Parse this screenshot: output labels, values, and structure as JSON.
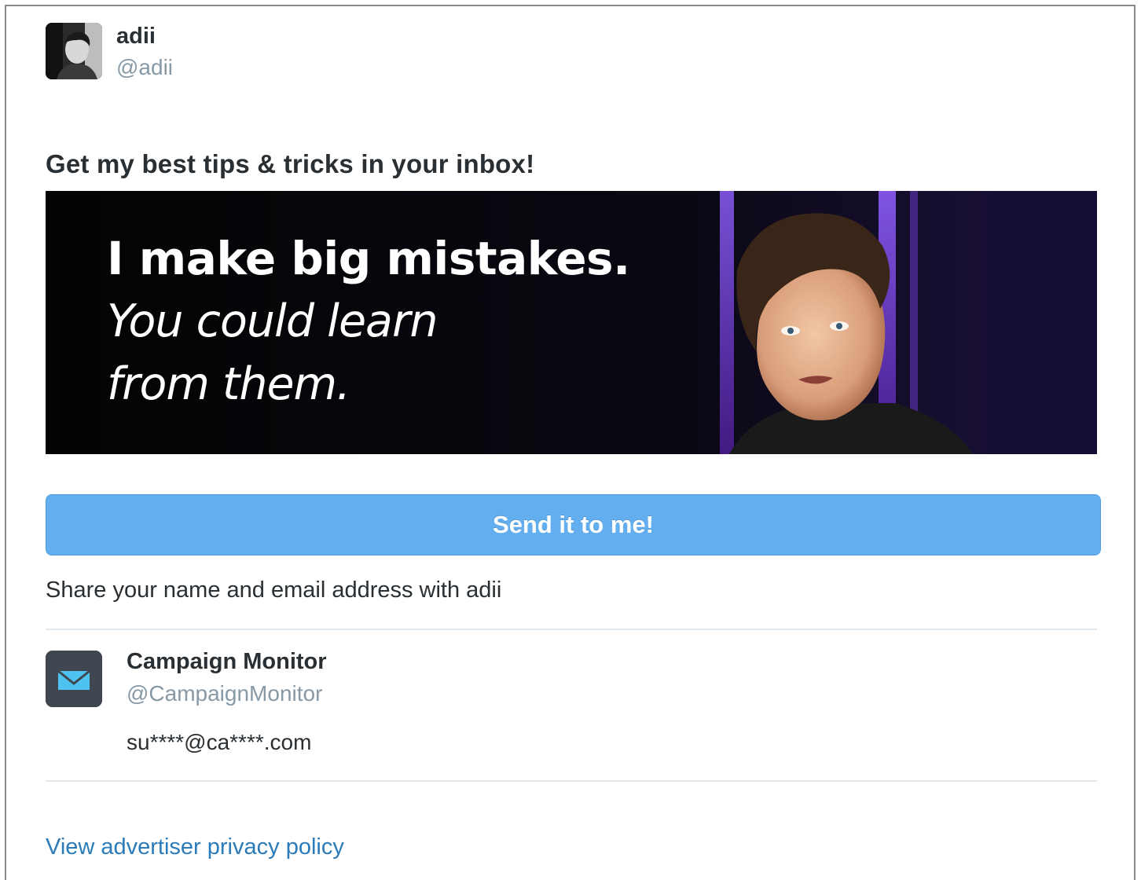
{
  "user": {
    "name": "adii",
    "handle": "@adii",
    "avatar_icon": "profile-photo"
  },
  "card": {
    "headline": "Get my best tips & tricks in your inbox!",
    "banner": {
      "line1": "I make big mistakes.",
      "line2": "You could learn",
      "line3": "from them."
    },
    "cta_label": "Send it to me!",
    "share_text": "Share your name and email address with adii"
  },
  "advertiser": {
    "name": "Campaign Monitor",
    "handle": "@CampaignMonitor",
    "logo_icon": "envelope-icon",
    "masked_email": "su****@ca****.com"
  },
  "footer": {
    "privacy_link": "View advertiser privacy policy"
  },
  "colors": {
    "button": "#63aeef",
    "link": "#2b7bb9",
    "muted": "#8899a6",
    "text": "#292f33",
    "logo_bg": "#3f4650",
    "logo_envelope": "#4ec3ef"
  }
}
